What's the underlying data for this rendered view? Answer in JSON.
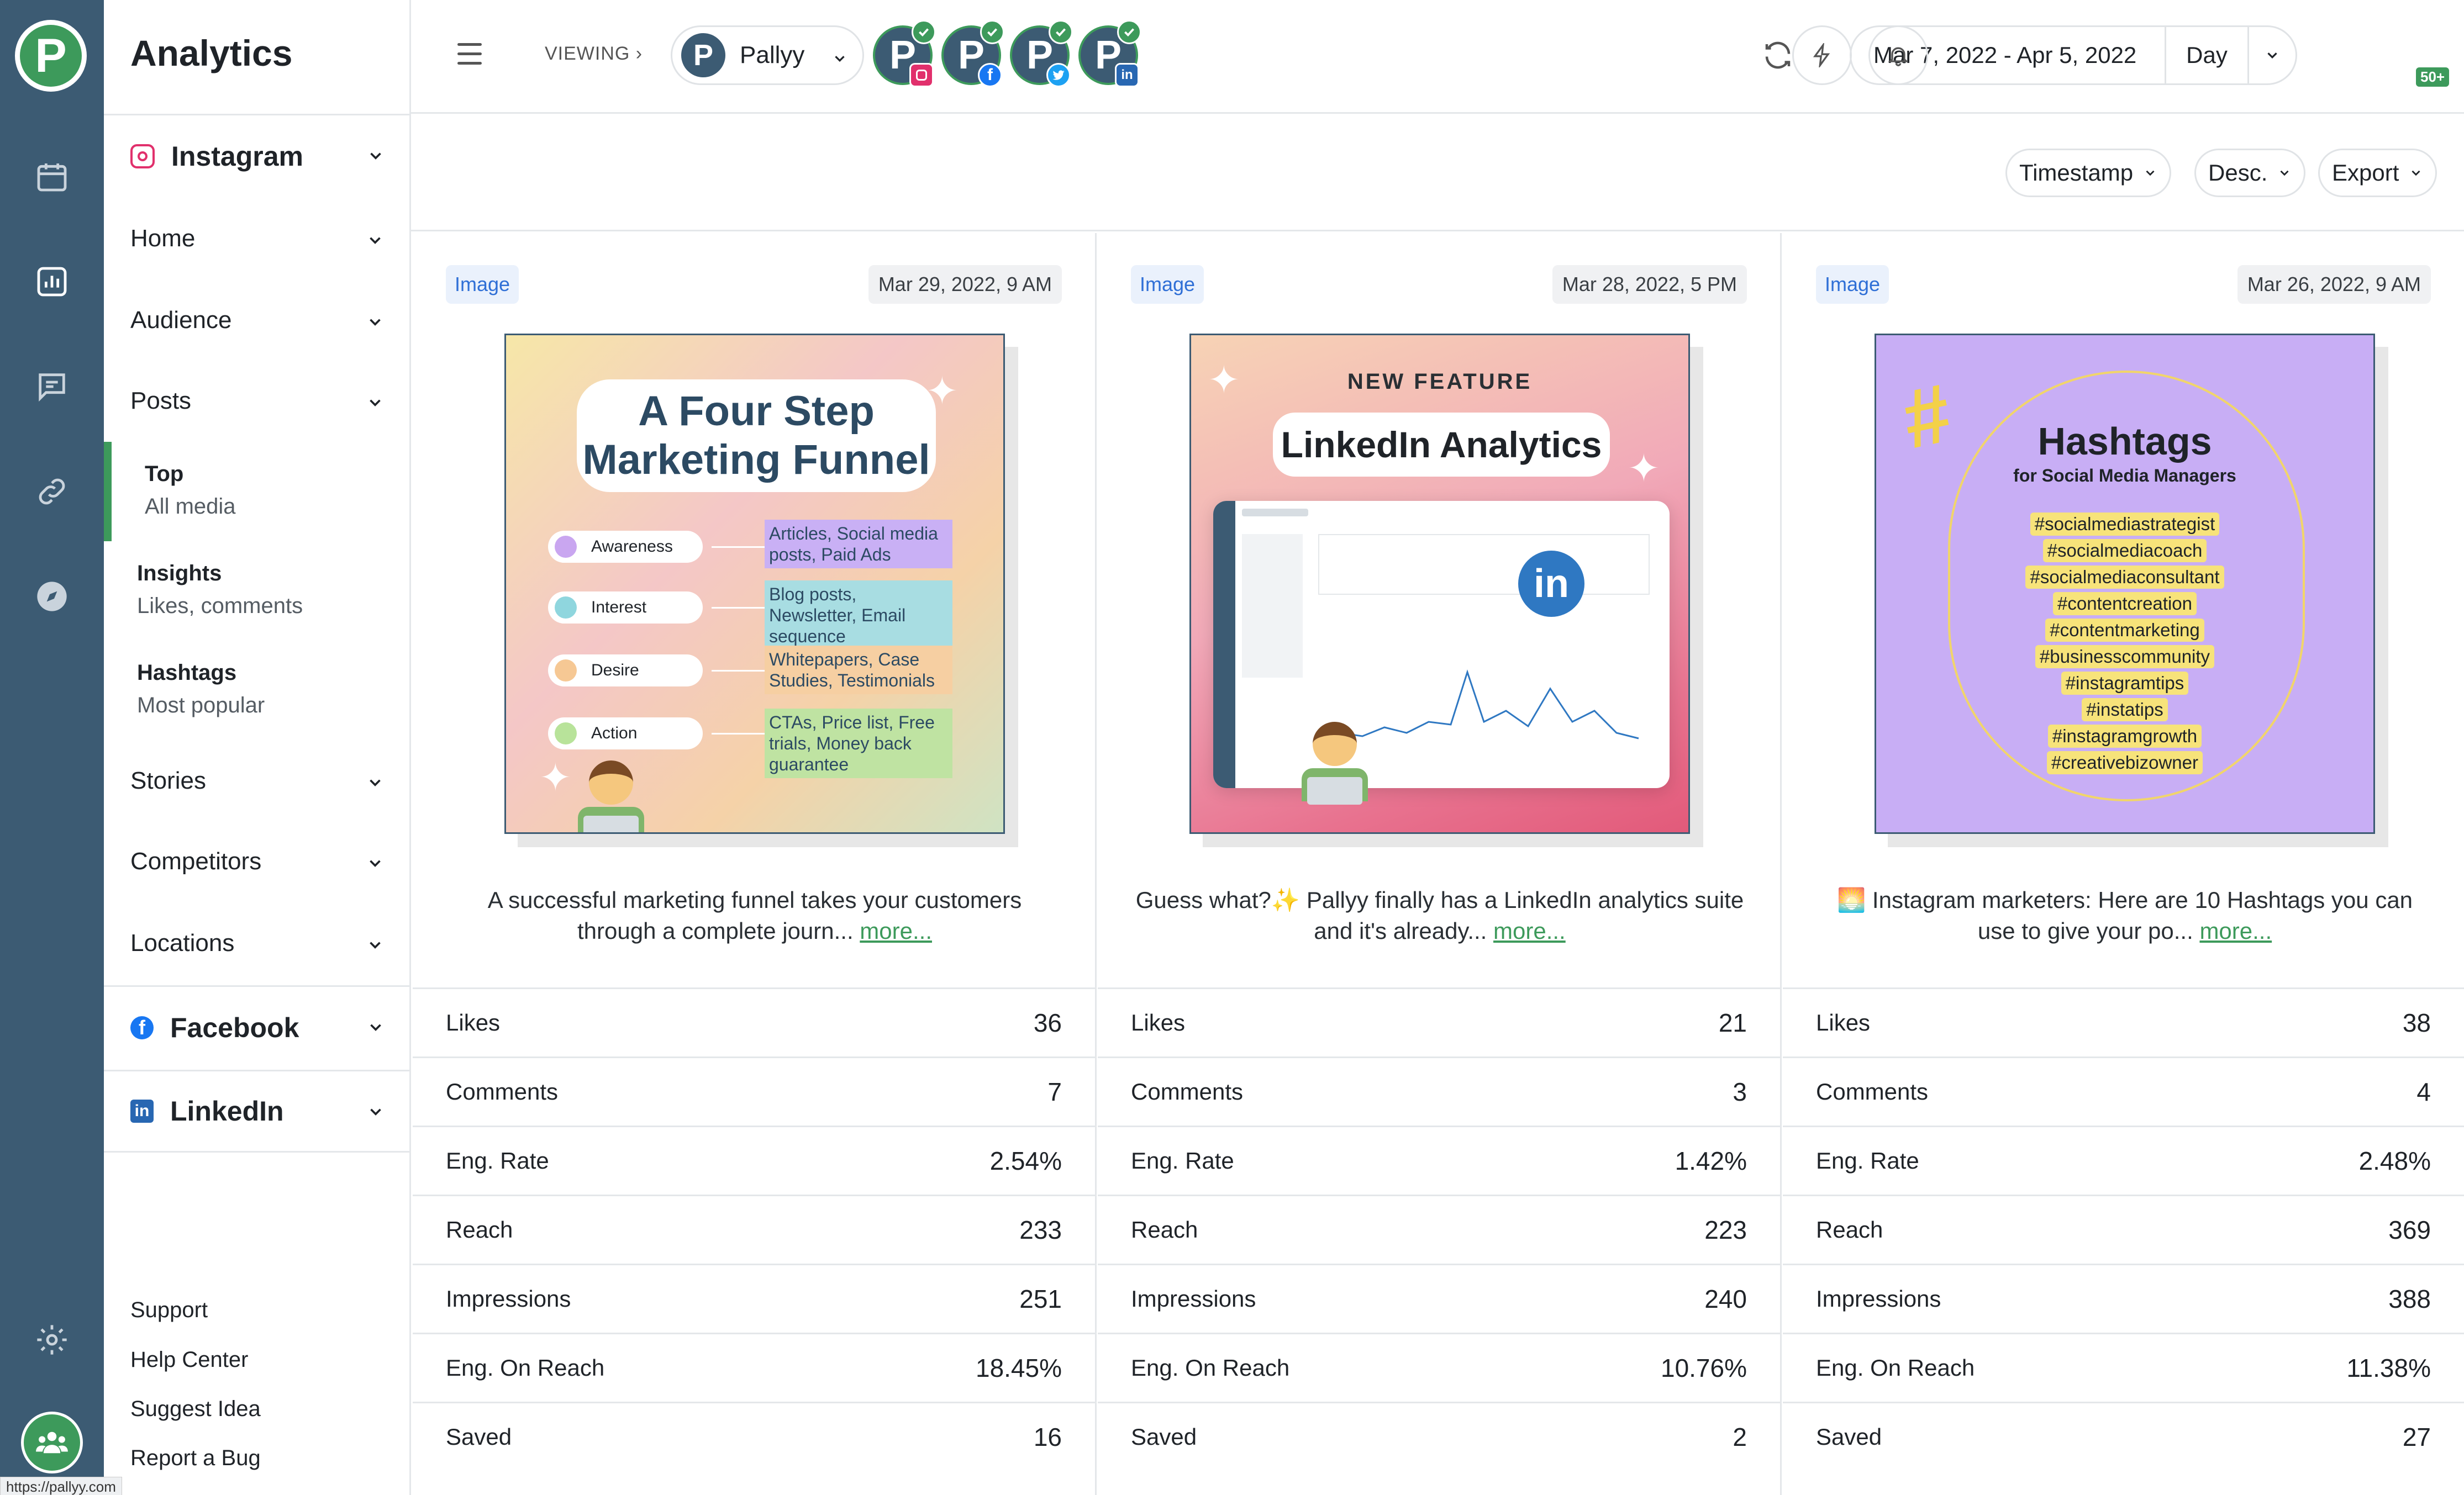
{
  "app": {
    "title": "Analytics"
  },
  "sidebar": {
    "instagram_label": "Instagram",
    "sections": [
      "Home",
      "Audience",
      "Posts"
    ],
    "posts_sub": [
      {
        "title": "Top",
        "sub": "All media"
      },
      {
        "title": "Insights",
        "sub": "Likes, comments"
      },
      {
        "title": "Hashtags",
        "sub": "Most popular"
      }
    ],
    "sections_after": [
      "Stories",
      "Competitors",
      "Locations"
    ],
    "facebook_label": "Facebook",
    "linkedin_label": "LinkedIn",
    "footer_links": [
      "Support",
      "Help Center",
      "Suggest Idea",
      "Report a Bug"
    ],
    "status_url": "https://pallyy.com"
  },
  "header": {
    "viewing_label": "VIEWING",
    "brand_name": "Pallyy",
    "brand_initial": "P",
    "accounts": [
      {
        "network": "instagram",
        "initial": "P"
      },
      {
        "network": "facebook",
        "initial": "P"
      },
      {
        "network": "twitter",
        "initial": "P"
      },
      {
        "network": "linkedin",
        "initial": "P"
      }
    ],
    "date_range": "Mar 7, 2022 - Apr 5, 2022",
    "granularity": "Day",
    "notification_count": "50+"
  },
  "toolbar": {
    "sort_field": "Timestamp",
    "sort_order": "Desc.",
    "export_label": "Export"
  },
  "posts": [
    {
      "type": "Image",
      "timestamp": "Mar 29, 2022, 9 AM",
      "image": {
        "title": "A Four Step Marketing Funnel",
        "stages": [
          {
            "name": "Awareness",
            "note": "Articles, Social media posts, Paid Ads"
          },
          {
            "name": "Interest",
            "note": "Blog posts, Newsletter, Email sequence"
          },
          {
            "name": "Desire",
            "note": "Whitepapers, Case Studies, Testimonials"
          },
          {
            "name": "Action",
            "note": "CTAs, Price list, Free trials, Money back guarantee"
          }
        ]
      },
      "caption": "A successful marketing funnel takes your customers through a complete journ...",
      "more_label": "more...",
      "metrics": [
        {
          "label": "Likes",
          "value": "36"
        },
        {
          "label": "Comments",
          "value": "7"
        },
        {
          "label": "Eng. Rate",
          "value": "2.54%"
        },
        {
          "label": "Reach",
          "value": "233"
        },
        {
          "label": "Impressions",
          "value": "251"
        },
        {
          "label": "Eng. On Reach",
          "value": "18.45%"
        },
        {
          "label": "Saved",
          "value": "16"
        }
      ]
    },
    {
      "type": "Image",
      "timestamp": "Mar 28, 2022, 5 PM",
      "image": {
        "subtitle": "NEW FEATURE",
        "title": "LinkedIn Analytics",
        "badge": "in"
      },
      "caption": "Guess what?✨ Pallyy finally has a LinkedIn analytics suite and it's already...",
      "more_label": "more...",
      "metrics": [
        {
          "label": "Likes",
          "value": "21"
        },
        {
          "label": "Comments",
          "value": "3"
        },
        {
          "label": "Eng. Rate",
          "value": "1.42%"
        },
        {
          "label": "Reach",
          "value": "223"
        },
        {
          "label": "Impressions",
          "value": "240"
        },
        {
          "label": "Eng. On Reach",
          "value": "10.76%"
        },
        {
          "label": "Saved",
          "value": "2"
        }
      ]
    },
    {
      "type": "Image",
      "timestamp": "Mar 26, 2022, 9 AM",
      "image": {
        "title": "Hashtags",
        "subtitle": "for Social Media Managers",
        "hashtags": [
          "#socialmediastrategist",
          "#socialmediacoach",
          "#socialmediaconsultant",
          "#contentcreation",
          "#contentmarketing",
          "#businesscommunity",
          "#instagramtips",
          "#instatips",
          "#instagramgrowth",
          "#creativebizowner"
        ]
      },
      "caption": "🌅 Instagram marketers: Here are 10 Hashtags you can use to give your po...",
      "more_label": "more...",
      "metrics": [
        {
          "label": "Likes",
          "value": "38"
        },
        {
          "label": "Comments",
          "value": "4"
        },
        {
          "label": "Eng. Rate",
          "value": "2.48%"
        },
        {
          "label": "Reach",
          "value": "369"
        },
        {
          "label": "Impressions",
          "value": "388"
        },
        {
          "label": "Eng. On Reach",
          "value": "11.38%"
        },
        {
          "label": "Saved",
          "value": "27"
        }
      ]
    }
  ],
  "colors": {
    "rail": "#3c5b73",
    "accent": "#3d9a5b",
    "tag_text": "#2f6fd6",
    "instagram": "#e1306c",
    "facebook": "#1877f2",
    "twitter": "#1da1f2",
    "linkedin": "#2867b2"
  }
}
